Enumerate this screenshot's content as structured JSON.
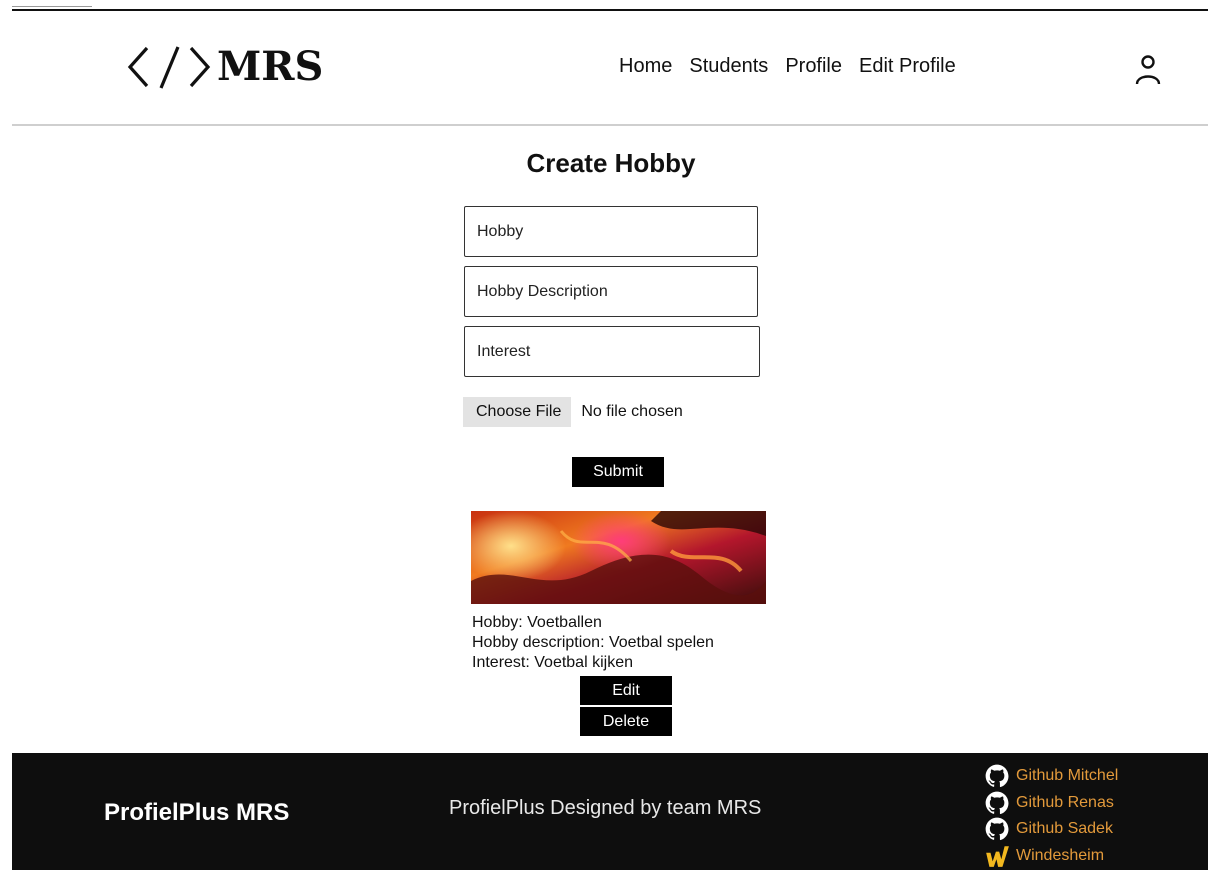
{
  "header": {
    "logo_text": "MRS",
    "nav": [
      {
        "label": "Home"
      },
      {
        "label": "Students"
      },
      {
        "label": "Profile"
      },
      {
        "label": "Edit Profile"
      }
    ]
  },
  "form": {
    "title": "Create Hobby",
    "hobby_placeholder": "Hobby",
    "description_placeholder": "Hobby Description",
    "interest_placeholder": "Interest",
    "choose_file_label": "Choose File",
    "no_file_text": "No file chosen",
    "submit_label": "Submit"
  },
  "hobby_card": {
    "hobby_line": "Hobby: Voetballen",
    "description_line": "Hobby description: Voetbal spelen",
    "interest_line": "Interest: Voetbal kijken",
    "edit_label": "Edit",
    "delete_label": "Delete"
  },
  "footer": {
    "brand": "ProfielPlus MRS",
    "credit": "ProfielPlus Designed by team MRS",
    "links": [
      {
        "label": "Github Mitchel",
        "icon": "github-icon"
      },
      {
        "label": "Github Renas",
        "icon": "github-icon"
      },
      {
        "label": "Github Sadek",
        "icon": "github-icon"
      },
      {
        "label": "Windesheim",
        "icon": "windesheim-icon"
      }
    ],
    "link_color": "#e39a3b"
  },
  "colors": {
    "button_bg": "#000000",
    "footer_bg": "#0e0e0e"
  }
}
